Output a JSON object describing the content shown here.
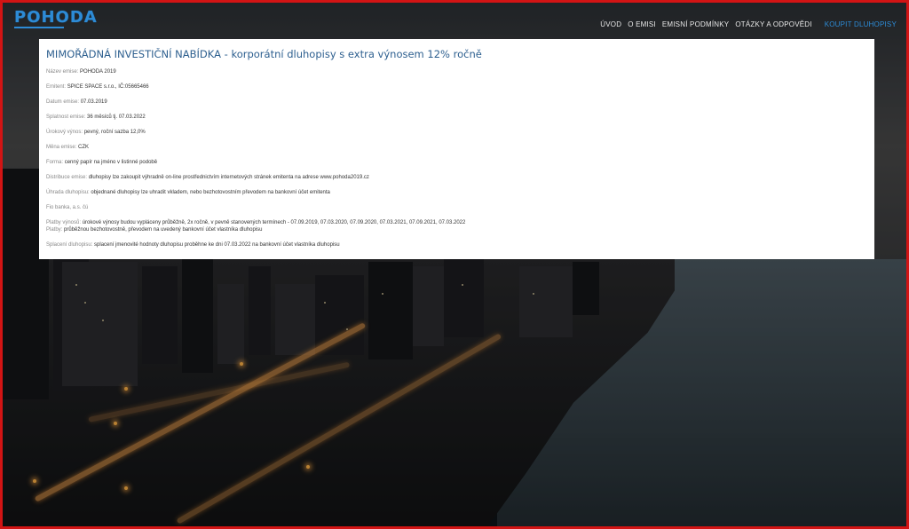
{
  "header": {
    "logo": "POHODA",
    "nav": [
      {
        "label": "ÚVOD"
      },
      {
        "label": "O EMISI"
      },
      {
        "label": "EMISNÍ PODMÍNKY"
      },
      {
        "label": "OTÁZKY A ODPOVĚDI"
      },
      {
        "label": "KOUPIT DLUHOPISY"
      }
    ]
  },
  "panel": {
    "title": "MIMOŘÁDNÁ INVESTIČNÍ NABÍDKA - korporátní dluhopisy s extra výnosem 12% ročně",
    "rows": [
      {
        "label": "Název emise:",
        "value": "POHODA 2019"
      },
      {
        "label": "Emitent:",
        "value": "SPICE SPACE s.r.o., IČ:05665466"
      },
      {
        "label": "Datum emise:",
        "value": "07.03.2019"
      },
      {
        "label": "Splatnost emise:",
        "value": "36 měsíců tj. 07.03.2022"
      },
      {
        "label": "Úrokový výnos:",
        "value": "pevný, roční sazba 12,0%"
      },
      {
        "label": "Měna emise:",
        "value": "CZK"
      },
      {
        "label": "Forma:",
        "value": "cenný papír na jméno v listinné podobě"
      },
      {
        "label": "Distribuce emise:",
        "value": "dluhopisy lze zakoupit výhradně on-line prostřednictvím internetových stránek emitenta na adrese www.pohoda2019.cz"
      },
      {
        "label": "Úhrada dluhopisu:",
        "value": "objednané dluhopisy lze uhradit vkladem, nebo bezhotovostním převodem na bankovní účet emitenta"
      },
      {
        "label": "Fio banka, a.s. čú",
        "value": ""
      },
      {
        "label": "Platby výnosů:",
        "value": "úrokové výnosy budou vypláceny průběžně, 2x ročně, v pevně stanovených termínech - 07.09.2019, 07.03.2020, 07.09.2020, 07.03.2021, 07.09.2021, 07.03.2022"
      },
      {
        "label": "Platby:",
        "value": "průběžnou bezhotovostně, převodem na uvedený bankovní účet vlastníka dluhopisu"
      },
      {
        "label": "Splacení dluhopisu:",
        "value": "splacení jmenovité hodnoty dluhopisu proběhne ke dni 07.03.2022 na bankovní účet vlastníka dluhopisu"
      }
    ]
  },
  "colors": {
    "brand": "#2d8bd6",
    "title": "#2d5f8f",
    "frame": "#d21414"
  }
}
